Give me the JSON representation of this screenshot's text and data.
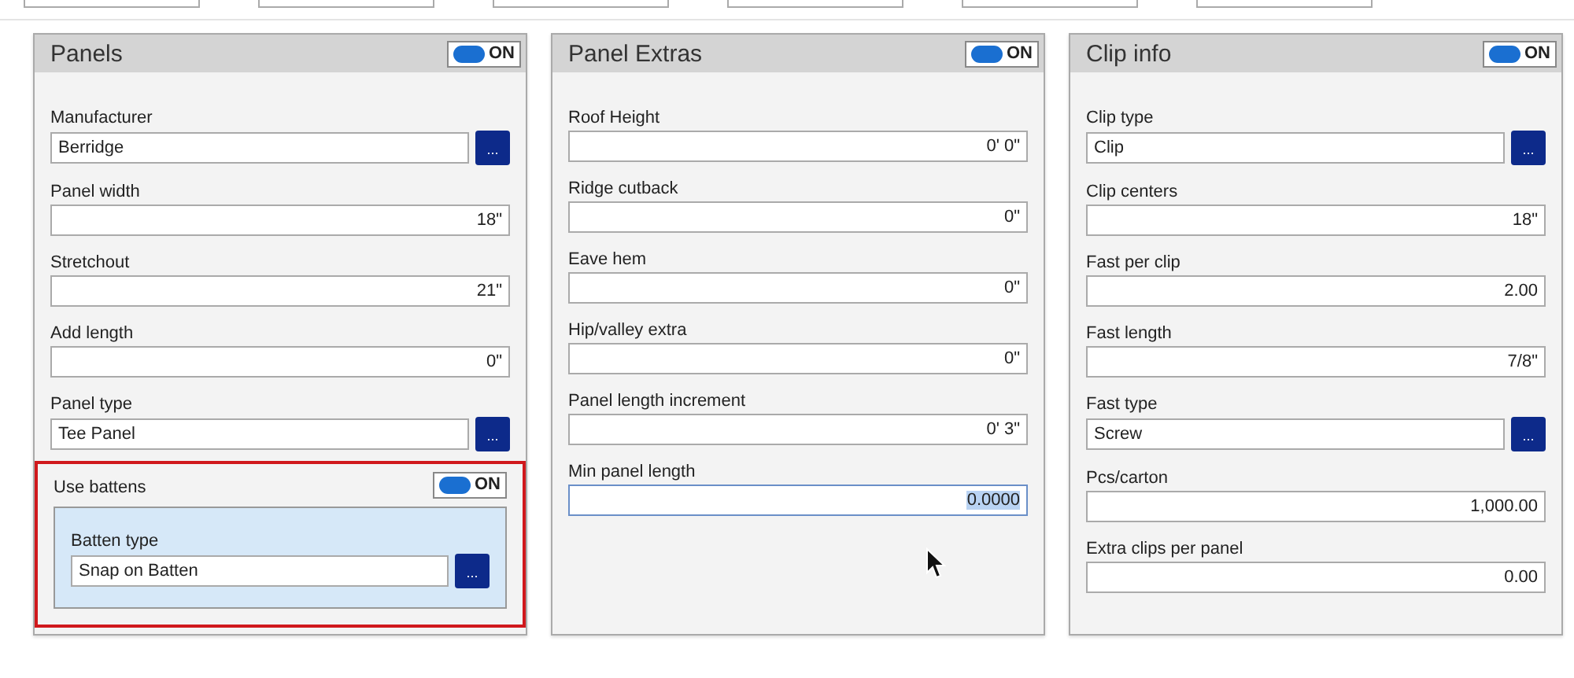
{
  "top_tabs": [
    {
      "selected": false
    },
    {
      "selected": false
    },
    {
      "selected": false
    },
    {
      "selected": false
    },
    {
      "selected": false
    },
    {
      "selected": false
    }
  ],
  "panels": [
    {
      "title": "Panels",
      "toggle": {
        "on": true,
        "label": "ON"
      },
      "fields": [
        {
          "kind": "lookup",
          "label": "Manufacturer",
          "value": "Berridge",
          "button": "..."
        },
        {
          "kind": "number",
          "label": "Panel width",
          "value": "18\"",
          "focused": false
        },
        {
          "kind": "number",
          "label": "Stretchout",
          "value": "21\"",
          "focused": false
        },
        {
          "kind": "number",
          "label": "Add length",
          "value": "0\"",
          "focused": false
        },
        {
          "kind": "lookup",
          "label": "Panel type",
          "value": "Tee Panel",
          "button": "..."
        },
        {
          "kind": "group",
          "label": "Use battens",
          "highlighted": true,
          "toggle": {
            "on": true,
            "label": "ON"
          },
          "fields": [
            {
              "kind": "lookup",
              "label": "Batten type",
              "value": "Snap on Batten",
              "button": "..."
            }
          ]
        }
      ]
    },
    {
      "title": "Panel Extras",
      "toggle": {
        "on": true,
        "label": "ON"
      },
      "fields": [
        {
          "kind": "number",
          "label": "Roof Height",
          "value": "0' 0\"",
          "focused": false
        },
        {
          "kind": "number",
          "label": "Ridge cutback",
          "value": "0\"",
          "focused": false
        },
        {
          "kind": "number",
          "label": "Eave hem",
          "value": "0\"",
          "focused": false
        },
        {
          "kind": "number",
          "label": "Hip/valley extra",
          "value": "0\"",
          "focused": false
        },
        {
          "kind": "number",
          "label": "Panel length increment",
          "value": "0' 3\"",
          "focused": false
        },
        {
          "kind": "number",
          "label": "Min panel length",
          "value": "0.0000",
          "focused": true
        }
      ]
    },
    {
      "title": "Clip info",
      "toggle": {
        "on": true,
        "label": "ON"
      },
      "fields": [
        {
          "kind": "lookup",
          "label": "Clip type",
          "value": "Clip",
          "button": "..."
        },
        {
          "kind": "number",
          "label": "Clip centers",
          "value": "18\"",
          "focused": false
        },
        {
          "kind": "number",
          "label": "Fast per clip",
          "value": "2.00",
          "focused": false
        },
        {
          "kind": "number",
          "label": "Fast length",
          "value": "7/8\"",
          "focused": false
        },
        {
          "kind": "lookup",
          "label": "Fast type",
          "value": "Screw",
          "button": "..."
        },
        {
          "kind": "number",
          "label": "Pcs/carton",
          "value": "1,000.00",
          "focused": false
        },
        {
          "kind": "number",
          "label": "Extra clips per panel",
          "value": "0.00",
          "focused": false
        }
      ]
    }
  ]
}
